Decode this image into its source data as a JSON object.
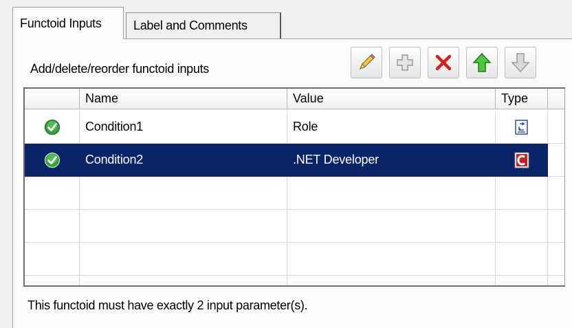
{
  "tabs": [
    {
      "label": "Functoid Inputs",
      "active": true
    },
    {
      "label": "Label and Comments",
      "active": false
    }
  ],
  "section_label": "Add/delete/reorder functoid inputs",
  "toolbar": [
    {
      "name": "edit-button",
      "icon": "pencil-icon"
    },
    {
      "name": "add-button",
      "icon": "plus-icon"
    },
    {
      "name": "delete-button",
      "icon": "red-x-icon"
    },
    {
      "name": "move-up-button",
      "icon": "green-up-arrow-icon"
    },
    {
      "name": "move-down-button",
      "icon": "gray-down-arrow-icon"
    }
  ],
  "grid": {
    "columns": [
      "Name",
      "Value",
      "Type"
    ],
    "rows": [
      {
        "name": "Condition1",
        "value": "Role",
        "type_icon": "link-type-icon",
        "status_icon": "green-check-icon",
        "selected": false
      },
      {
        "name": "Condition2",
        "value": ".NET Developer",
        "type_icon": "constant-c-icon",
        "status_icon": "green-check-icon",
        "selected": true
      }
    ]
  },
  "footer_text": "This functoid must have exactly 2 input parameter(s).",
  "colors": {
    "selection": "#0a246a",
    "accent_green": "#3aa13a",
    "delete_red": "#d42020"
  }
}
